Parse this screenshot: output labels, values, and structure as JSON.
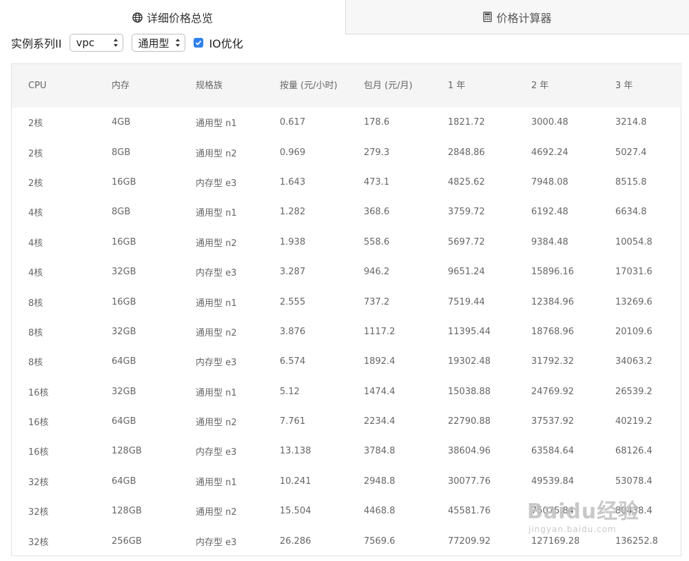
{
  "tabs": [
    {
      "label": "详细价格总览",
      "icon": "globe-icon",
      "active": true
    },
    {
      "label": "价格计算器",
      "icon": "calculator-icon",
      "active": false
    }
  ],
  "filters": {
    "series_label": "实例系列II",
    "network_select": "vpc",
    "type_select": "通用型",
    "io_checkbox_label": "IO优化",
    "io_checked": true
  },
  "table": {
    "headers": [
      "CPU",
      "内存",
      "规格族",
      "按量 (元/小时)",
      "包月 (元/月)",
      "1 年",
      "2 年",
      "3 年"
    ],
    "rows": [
      [
        "2核",
        "4GB",
        "通用型 n1",
        "0.617",
        "178.6",
        "1821.72",
        "3000.48",
        "3214.8"
      ],
      [
        "2核",
        "8GB",
        "通用型 n2",
        "0.969",
        "279.3",
        "2848.86",
        "4692.24",
        "5027.4"
      ],
      [
        "2核",
        "16GB",
        "内存型 e3",
        "1.643",
        "473.1",
        "4825.62",
        "7948.08",
        "8515.8"
      ],
      [
        "4核",
        "8GB",
        "通用型 n1",
        "1.282",
        "368.6",
        "3759.72",
        "6192.48",
        "6634.8"
      ],
      [
        "4核",
        "16GB",
        "通用型 n2",
        "1.938",
        "558.6",
        "5697.72",
        "9384.48",
        "10054.8"
      ],
      [
        "4核",
        "32GB",
        "内存型 e3",
        "3.287",
        "946.2",
        "9651.24",
        "15896.16",
        "17031.6"
      ],
      [
        "8核",
        "16GB",
        "通用型 n1",
        "2.555",
        "737.2",
        "7519.44",
        "12384.96",
        "13269.6"
      ],
      [
        "8核",
        "32GB",
        "通用型 n2",
        "3.876",
        "1117.2",
        "11395.44",
        "18768.96",
        "20109.6"
      ],
      [
        "8核",
        "64GB",
        "内存型 e3",
        "6.574",
        "1892.4",
        "19302.48",
        "31792.32",
        "34063.2"
      ],
      [
        "16核",
        "32GB",
        "通用型 n1",
        "5.12",
        "1474.4",
        "15038.88",
        "24769.92",
        "26539.2"
      ],
      [
        "16核",
        "64GB",
        "通用型 n2",
        "7.761",
        "2234.4",
        "22790.88",
        "37537.92",
        "40219.2"
      ],
      [
        "16核",
        "128GB",
        "内存型 e3",
        "13.138",
        "3784.8",
        "38604.96",
        "63584.64",
        "68126.4"
      ],
      [
        "32核",
        "64GB",
        "通用型 n1",
        "10.241",
        "2948.8",
        "30077.76",
        "49539.84",
        "53078.4"
      ],
      [
        "32核",
        "128GB",
        "通用型 n2",
        "15.504",
        "4468.8",
        "45581.76",
        "75075.84",
        "80438.4"
      ],
      [
        "32核",
        "256GB",
        "内存型 e3",
        "26.286",
        "7569.6",
        "77209.92",
        "127169.28",
        "136252.8"
      ]
    ]
  },
  "watermark": {
    "brand": "Baidu经验",
    "url": "jingyan.baidu.com"
  },
  "colors": {
    "checkbox": "#2f80ed",
    "header_bg": "#f5f5f5",
    "inactive_tab_bg": "#f7f7f7"
  }
}
